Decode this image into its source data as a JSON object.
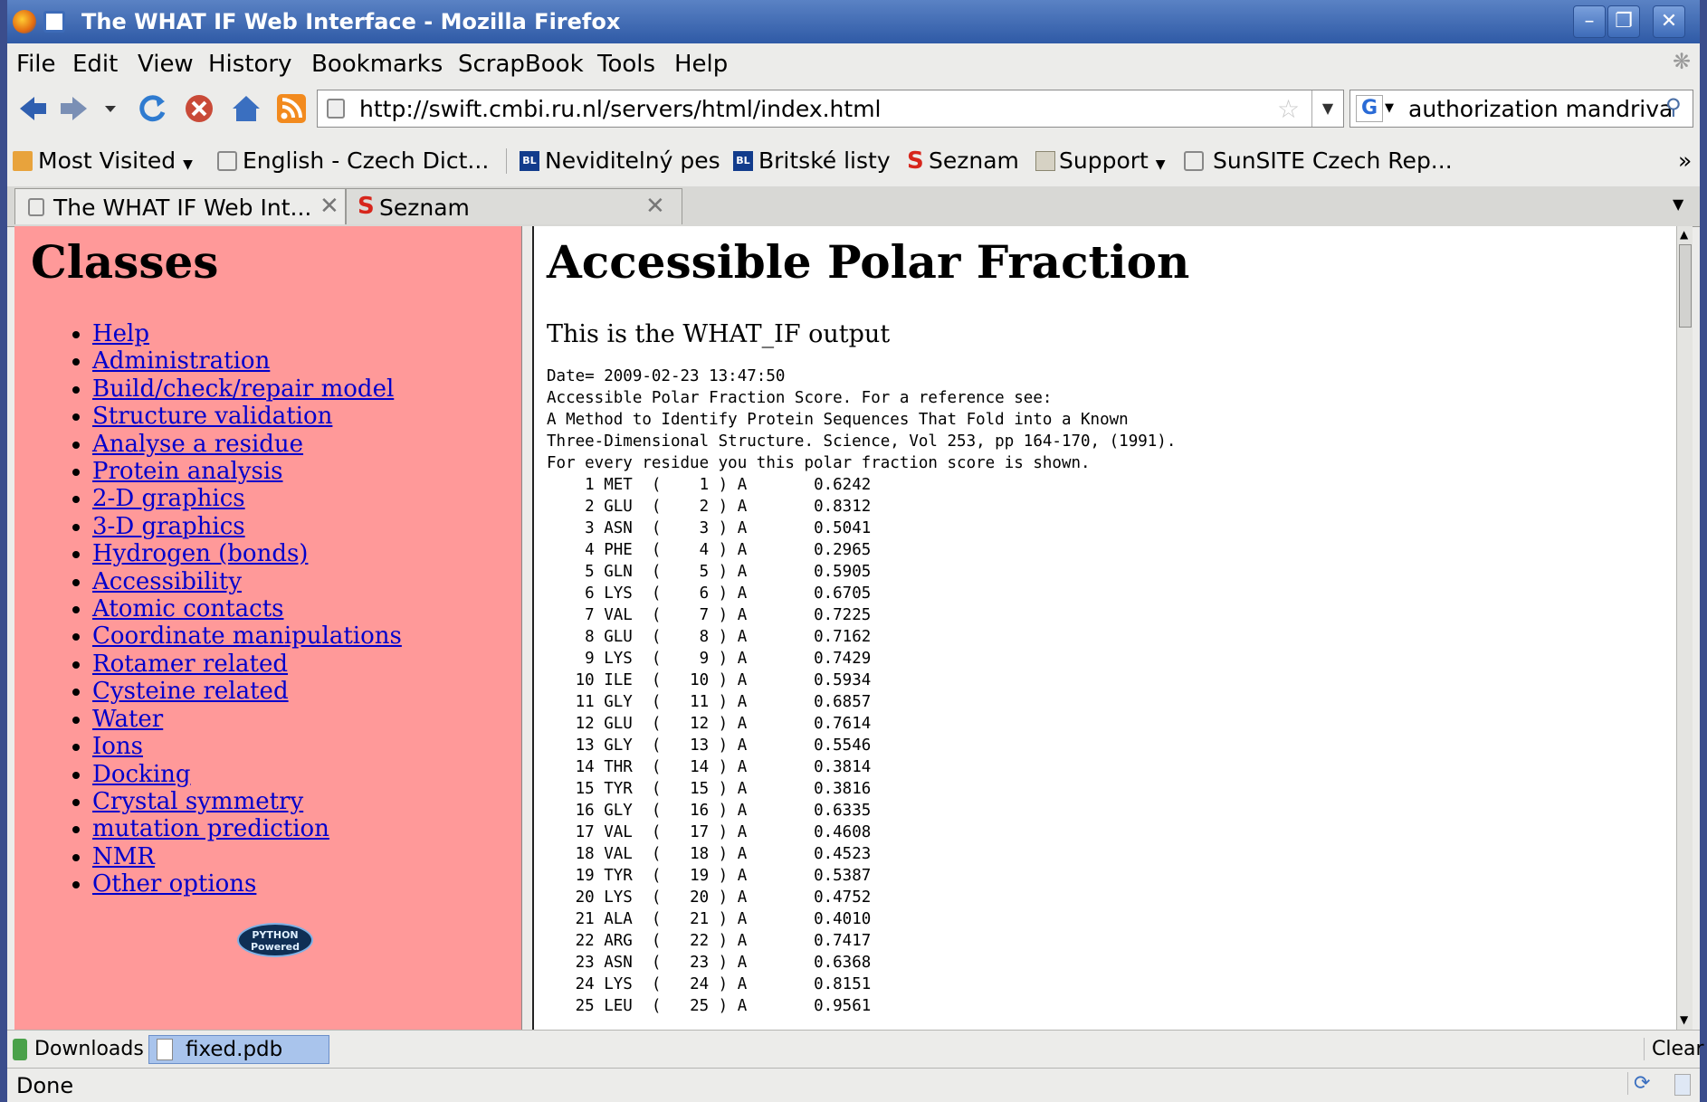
{
  "window": {
    "title": "The WHAT IF Web Interface - Mozilla Firefox"
  },
  "menu": [
    "File",
    "Edit",
    "View",
    "History",
    "Bookmarks",
    "ScrapBook",
    "Tools",
    "Help"
  ],
  "navbar": {
    "url": "http://swift.cmbi.ru.nl/servers/html/index.html",
    "search_value": "authorization mandriva"
  },
  "bookmarks": [
    "Most Visited",
    "English - Czech Dict...",
    "Neviditelný pes",
    "Britské listy",
    "Seznam",
    "Support",
    "SunSITE Czech Rep..."
  ],
  "bookmark_badge": "BL",
  "bookmark_overflow": "»",
  "tabs": [
    {
      "label": "The WHAT IF Web Int...",
      "close": "✕"
    },
    {
      "label": "Seznam",
      "close": "✕"
    }
  ],
  "left_frame": {
    "heading": "Classes",
    "items": [
      "Help",
      "Administration",
      "Build/check/repair model",
      "Structure validation",
      "Analyse a residue",
      "Protein analysis",
      "2-D graphics",
      "3-D graphics",
      "Hydrogen (bonds)",
      "Accessibility",
      "Atomic contacts",
      "Coordinate manipulations",
      "Rotamer related",
      "Cysteine related",
      "Water",
      "Ions",
      "Docking",
      "Crystal symmetry",
      "mutation prediction",
      "NMR",
      "Other options"
    ],
    "badge_line1": "PYTHON",
    "badge_line2": "Powered"
  },
  "right_frame": {
    "heading": "Accessible Polar Fraction",
    "subtitle": "This is the WHAT_IF output",
    "header_lines": [
      "Date= 2009-02-23 13:47:50",
      "Accessible Polar Fraction Score. For a reference see:",
      "A Method to Identify Protein Sequences That Fold into a Known",
      "Three-Dimensional Structure. Science, Vol 253, pp 164-170, (1991).",
      "For every residue you this polar fraction score is shown."
    ],
    "residues": [
      {
        "n": "1",
        "res": "MET",
        "chain": "A",
        "score": "0.6242"
      },
      {
        "n": "2",
        "res": "GLU",
        "chain": "A",
        "score": "0.8312"
      },
      {
        "n": "3",
        "res": "ASN",
        "chain": "A",
        "score": "0.5041"
      },
      {
        "n": "4",
        "res": "PHE",
        "chain": "A",
        "score": "0.2965"
      },
      {
        "n": "5",
        "res": "GLN",
        "chain": "A",
        "score": "0.5905"
      },
      {
        "n": "6",
        "res": "LYS",
        "chain": "A",
        "score": "0.6705"
      },
      {
        "n": "7",
        "res": "VAL",
        "chain": "A",
        "score": "0.7225"
      },
      {
        "n": "8",
        "res": "GLU",
        "chain": "A",
        "score": "0.7162"
      },
      {
        "n": "9",
        "res": "LYS",
        "chain": "A",
        "score": "0.7429"
      },
      {
        "n": "10",
        "res": "ILE",
        "chain": "A",
        "score": "0.5934"
      },
      {
        "n": "11",
        "res": "GLY",
        "chain": "A",
        "score": "0.6857"
      },
      {
        "n": "12",
        "res": "GLU",
        "chain": "A",
        "score": "0.7614"
      },
      {
        "n": "13",
        "res": "GLY",
        "chain": "A",
        "score": "0.5546"
      },
      {
        "n": "14",
        "res": "THR",
        "chain": "A",
        "score": "0.3814"
      },
      {
        "n": "15",
        "res": "TYR",
        "chain": "A",
        "score": "0.3816"
      },
      {
        "n": "16",
        "res": "GLY",
        "chain": "A",
        "score": "0.6335"
      },
      {
        "n": "17",
        "res": "VAL",
        "chain": "A",
        "score": "0.4608"
      },
      {
        "n": "18",
        "res": "VAL",
        "chain": "A",
        "score": "0.4523"
      },
      {
        "n": "19",
        "res": "TYR",
        "chain": "A",
        "score": "0.5387"
      },
      {
        "n": "20",
        "res": "LYS",
        "chain": "A",
        "score": "0.4752"
      },
      {
        "n": "21",
        "res": "ALA",
        "chain": "A",
        "score": "0.4010"
      },
      {
        "n": "22",
        "res": "ARG",
        "chain": "A",
        "score": "0.7417"
      },
      {
        "n": "23",
        "res": "ASN",
        "chain": "A",
        "score": "0.6368"
      },
      {
        "n": "24",
        "res": "LYS",
        "chain": "A",
        "score": "0.8151"
      },
      {
        "n": "25",
        "res": "LEU",
        "chain": "A",
        "score": "0.9561"
      }
    ]
  },
  "downloads_bar": {
    "label": "Downloads",
    "file": "fixed.pdb",
    "clear": "Clear"
  },
  "status": "Done",
  "colors": {
    "left_frame_bg": "#ff9999",
    "link": "#0000cc",
    "titlebar": "#3d6bb8"
  }
}
